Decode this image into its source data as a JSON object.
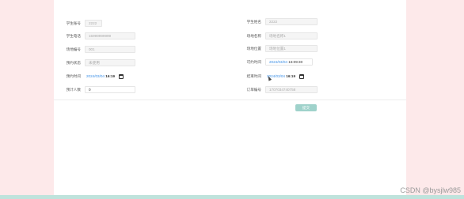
{
  "form": {
    "student_no": {
      "label": "学生账号",
      "value": "2222"
    },
    "student_name": {
      "label": "学生姓名",
      "value": "2222"
    },
    "student_phone": {
      "label": "学生电话",
      "value": "15999999999"
    },
    "venue_name": {
      "label": "场地名称",
      "value": "场地名称1"
    },
    "venue_code": {
      "label": "场地编号",
      "value": "001"
    },
    "venue_location": {
      "label": "场地位置",
      "value": "场地位置1"
    },
    "reserve_status": {
      "label": "预约状态",
      "value": "未使用"
    },
    "bookable_time": {
      "label": "可约时间",
      "value_date": "2024/03/04",
      "value_time": "16:09:30"
    },
    "start_time": {
      "label": "预约时间",
      "value_date": "2024/03/04",
      "value_time": "16:19"
    },
    "end_time": {
      "label": "结束时间",
      "value_date": "2024/03/04",
      "value_time": "16:19"
    },
    "people_count": {
      "label": "预计人数",
      "value": "0"
    },
    "order_no": {
      "label": "订单编号",
      "value": "1707034740758"
    }
  },
  "submit_label": "提交",
  "watermark": "CSDN @bysjlw985"
}
